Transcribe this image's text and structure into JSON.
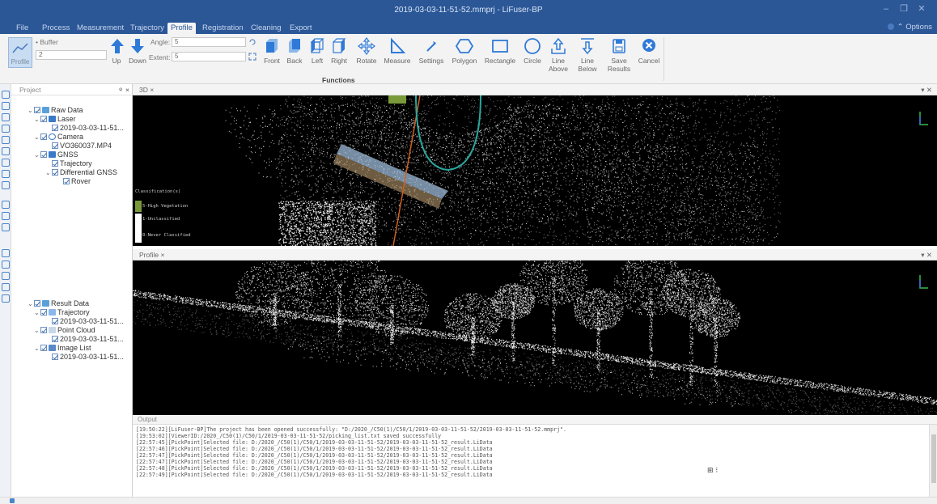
{
  "window": {
    "title": "2019-03-03-11-51-52.mmprj - LiFuser-BP"
  },
  "menu": {
    "items": [
      "File",
      "Process",
      "Measurement",
      "Trajectory",
      "Profile",
      "Registration",
      "Cleaning",
      "Export"
    ],
    "active": "Profile",
    "options_label": "Options"
  },
  "ribbon": {
    "profile_label": "Profile",
    "buffer_label": "Buffer",
    "buffer_value": "2",
    "up_label": "Up",
    "down_label": "Down",
    "angle_label": "Angle:",
    "angle_value": "5",
    "extent_label": "Extent:",
    "extent_value": "5",
    "buttons": {
      "front": "Front",
      "back": "Back",
      "left": "Left",
      "right": "Right",
      "rotate": "Rotate",
      "measure": "Measure",
      "settings": "Settings",
      "polygon": "Polygon",
      "rectangle": "Rectangle",
      "circle": "Circle",
      "line_above_1": "Line",
      "line_above_2": "Above",
      "line_below_1": "Line",
      "line_below_2": "Below",
      "save_1": "Save",
      "save_2": "Results",
      "cancel": "Cancel"
    },
    "group_label": "Functions"
  },
  "project": {
    "header": "Project",
    "raw_data": "Raw Data",
    "laser": "Laser",
    "laser_file": "2019-03-03-11-51...",
    "camera": "Camera",
    "camera_file": "VO360037.MP4",
    "gnss": "GNSS",
    "trajectory": "Trajectory",
    "diff_gnss": "Differential GNSS",
    "rover": "Rover",
    "result_data": "Result Data",
    "res_trajectory": "Trajectory",
    "res_traj_file": "2019-03-03-11-51...",
    "point_cloud": "Point Cloud",
    "pc_file": "2019-03-03-11-51...",
    "image_list": "Image List",
    "il_file": "2019-03-03-11-51..."
  },
  "views": {
    "view3d_tab": "3D",
    "profile_tab": "Profile",
    "legend_title": "Classification(s)",
    "legend_items": [
      "5-High Vegetation",
      "1-Unclassified",
      "0-Never Classified"
    ]
  },
  "colors": {
    "titlebar": "#2b5797",
    "vegetation": "#7a9a3a",
    "trajectory": "#2aa8a0",
    "profile_line": "#d06020",
    "buffer_box": "#a8c8e8"
  },
  "output": {
    "header": "Output",
    "lines": [
      "[19:50:22][LiFuser-BP]The project has been opened successfully: \"D:/2020_/C50(1)/C50/1/2019-03-03-11-51-52/2019-03-03-11-51-52.mmprj\".",
      "[19:53:02][ViewerID:/2020_/C50(1)/C50/1/2019-03-03-11-51-52/picking_list.txt saved successfully",
      "[22:57:45][PickPoint]Selected file: D:/2020_/C50(1)/C50/1/2019-03-03-11-51-52/2019-03-03-11-51-52_result.LiData",
      "[22:57:46][PickPoint]Selected file: D:/2020_/C50(1)/C50/1/2019-03-03-11-51-52/2019-03-03-11-51-52_result.LiData",
      "[22:57:47][PickPoint]Selected file: D:/2020_/C50(1)/C50/1/2019-03-03-11-51-52/2019-03-03-11-51-52_result.LiData",
      "[22:57:47][PickPoint]Selected file: D:/2020_/C50(1)/C50/1/2019-03-03-11-51-52/2019-03-03-11-51-52_result.LiData",
      "[22:57:48][PickPoint]Selected file: D:/2020_/C50(1)/C50/1/2019-03-03-11-51-52/2019-03-03-11-51-52_result.LiData",
      "[22:57:49][PickPoint]Selected file: D:/2020_/C50(1)/C50/1/2019-03-03-11-51-52/2019-03-03-11-51-52_result.LiData"
    ]
  }
}
